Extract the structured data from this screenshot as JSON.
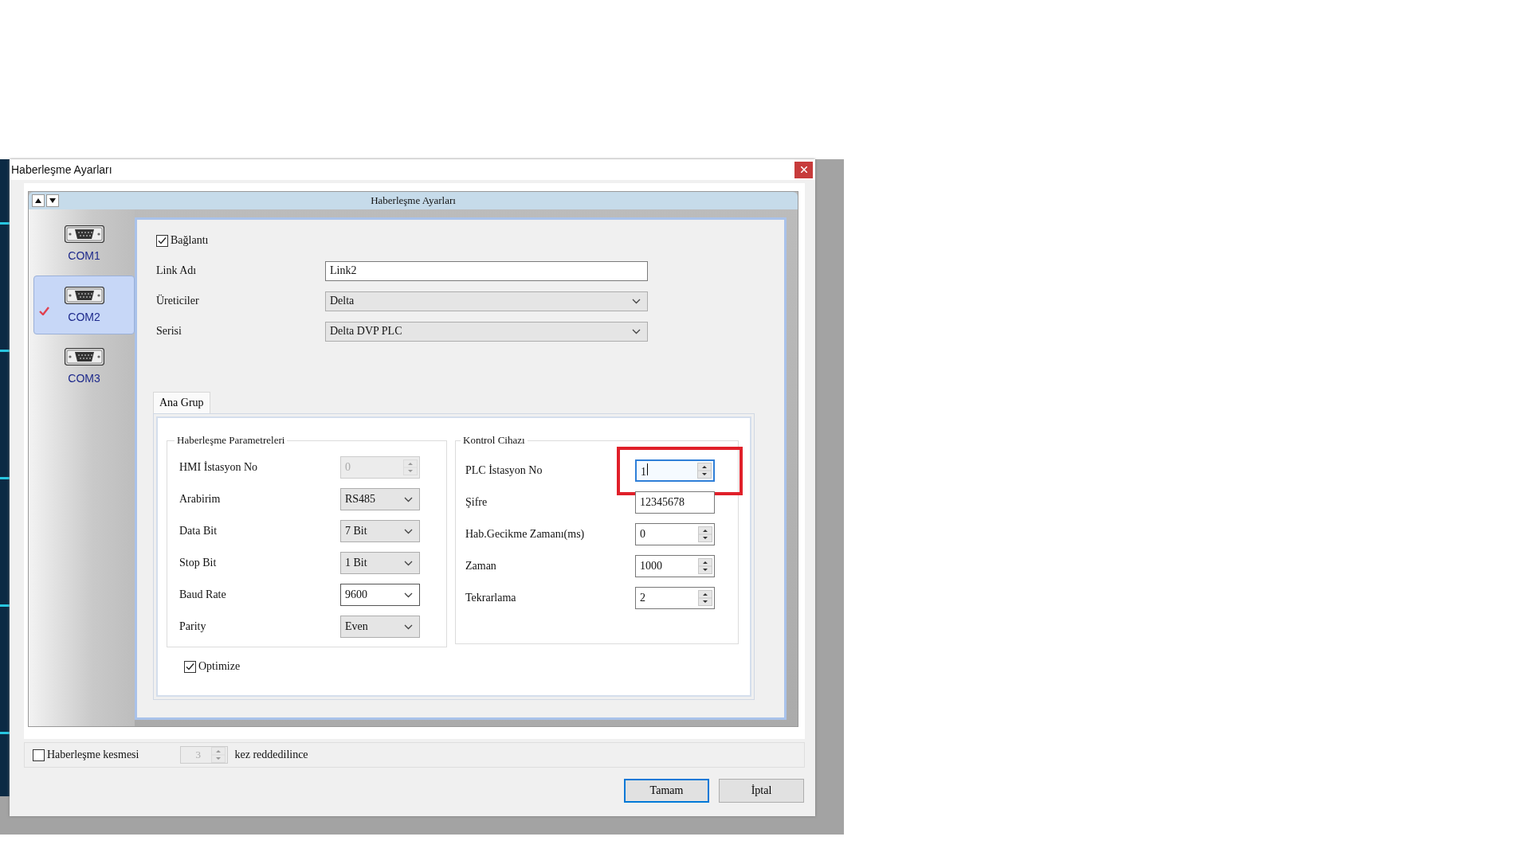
{
  "window": {
    "title": "Haberleşme Ayarları"
  },
  "panel": {
    "title": "Haberleşme Ayarları"
  },
  "ports": [
    {
      "label": "COM1",
      "selected": false,
      "checked": false
    },
    {
      "label": "COM2",
      "selected": true,
      "checked": true
    },
    {
      "label": "COM3",
      "selected": false,
      "checked": false
    }
  ],
  "connection": {
    "label": "Bağlantı",
    "checked": true
  },
  "link_fields": [
    {
      "label": "Link Adı",
      "kind": "text",
      "value": "Link2"
    },
    {
      "label": "Üreticiler",
      "kind": "dropdown",
      "value": "Delta"
    },
    {
      "label": "Serisi",
      "kind": "dropdown",
      "value": "Delta DVP PLC"
    }
  ],
  "tabs": [
    {
      "label": "Ana Grup",
      "selected": true
    }
  ],
  "communication_parameters": {
    "title": "Haberleşme Parametreleri",
    "fields": [
      {
        "label": "HMI İstasyon No",
        "kind": "spin",
        "value": "0",
        "disabled": true
      },
      {
        "label": "Arabirim",
        "kind": "dropdown",
        "value": "RS485"
      },
      {
        "label": "Data Bit",
        "kind": "dropdown",
        "value": "7 Bit"
      },
      {
        "label": "Stop Bit",
        "kind": "dropdown",
        "value": "1 Bit"
      },
      {
        "label": "Baud Rate",
        "kind": "combo",
        "value": "9600"
      },
      {
        "label": "Parity",
        "kind": "dropdown",
        "value": "Even"
      }
    ]
  },
  "optimize": {
    "label": "Optimize",
    "checked": true
  },
  "controller": {
    "title": "Kontrol Cihazı",
    "fields": [
      {
        "label": "PLC İstasyon No",
        "kind": "spin",
        "value": "1",
        "focused": true,
        "highlighted": true
      },
      {
        "label": "Şifre",
        "kind": "text",
        "value": "12345678"
      },
      {
        "label": "Hab.Gecikme Zamanı(ms)",
        "kind": "spin",
        "value": "0"
      },
      {
        "label": "Zaman",
        "kind": "spin",
        "value": "1000"
      },
      {
        "label": "Tekrarlama",
        "kind": "spin",
        "value": "2"
      }
    ]
  },
  "disconnect": {
    "label": "Haberleşme kesmesi",
    "checked": false,
    "count": "3",
    "count_disabled": true,
    "suffix": "kez reddedilince"
  },
  "buttons": [
    {
      "label": "Tamam",
      "default": true
    },
    {
      "label": "İptal",
      "default": false
    }
  ]
}
